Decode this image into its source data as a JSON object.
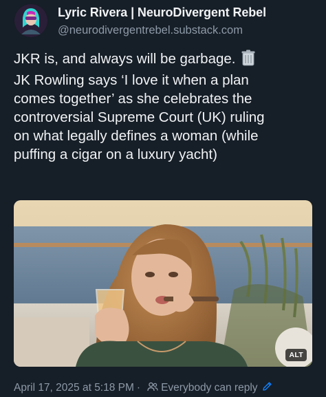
{
  "author": {
    "display_name": "Lyric Rivera | NeuroDivergent Rebel",
    "handle": "@neurodivergentrebel.substack.com",
    "avatar_icon": "avatar-icon"
  },
  "post": {
    "lines_para1": [
      "JKR is, and always will be garbage."
    ],
    "lines_para2": [
      "JK Rowling says ‘I love it when a plan",
      "comes together’ as she celebrates the",
      "controversial Supreme Court (UK) ruling",
      "on what legally defines a woman (while",
      "puffing a cigar on a luxury yacht)"
    ],
    "emoji_icon": "trash-can-icon"
  },
  "media": {
    "alt_label": "ALT"
  },
  "meta": {
    "date": "April 17, 2025 at 5:18 PM",
    "separator": "·",
    "reply_setting": "Everybody can reply",
    "reply_icon": "people-icon",
    "edit_icon": "pencil-icon"
  },
  "colors": {
    "background": "#161e27",
    "text": "#f1f3f5",
    "muted": "#8d9aa8",
    "link": "#1083fe"
  }
}
